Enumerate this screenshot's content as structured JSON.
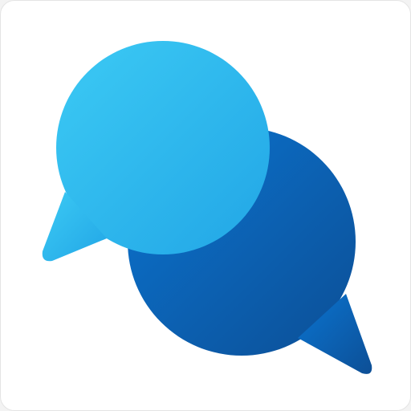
{
  "app_icon": {
    "icon": "chat-bubbles-icon",
    "colors": {
      "background": "#ffffff",
      "front_bubble_light": "#3ccaf4",
      "front_bubble_dark": "#22a6e6",
      "back_bubble_light": "#0a74d0",
      "back_bubble_dark": "#0d4f96"
    }
  }
}
